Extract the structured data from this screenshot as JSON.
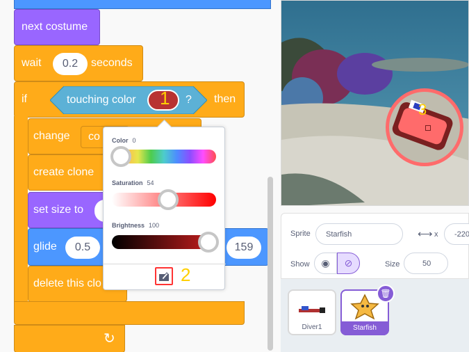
{
  "blocks": {
    "next_costume": "next costume",
    "wait_label": "wait",
    "wait_value": "0.2",
    "seconds_label": "seconds",
    "if_label": "if",
    "touching_color_label": "touching color",
    "question_mark": "?",
    "then_label": "then",
    "change_label": "change",
    "change_field": "co",
    "create_clone": "create clone",
    "set_size_label": "set size to",
    "glide_label": "glide",
    "glide_value": "0.5",
    "glide_y": "159",
    "delete_clone": "delete this clo"
  },
  "color_picker": {
    "color_label": "Color",
    "color_value": "0",
    "saturation_label": "Saturation",
    "saturation_value": "54",
    "brightness_label": "Brightness",
    "brightness_value": "100",
    "color_level": 0.0,
    "saturation_level": 0.54,
    "brightness_level": 1.0
  },
  "annotations": {
    "one": "1",
    "two": "2",
    "three": "3"
  },
  "sprite_info": {
    "sprite_label": "Sprite",
    "sprite_name": "Starfish",
    "x_label": "x",
    "x_value": "-220",
    "show_label": "Show",
    "size_label": "Size",
    "size_value": "50"
  },
  "sprites": [
    {
      "name": "Diver1"
    },
    {
      "name": "Starfish"
    }
  ],
  "colors": {
    "looks": "#9966ff",
    "control": "#ffab19",
    "motion": "#4c97ff",
    "sensing": "#5cb1d6",
    "selected_sprite": "#855cd6",
    "annotation": "#ffcf00",
    "highlight": "#ff3333"
  }
}
